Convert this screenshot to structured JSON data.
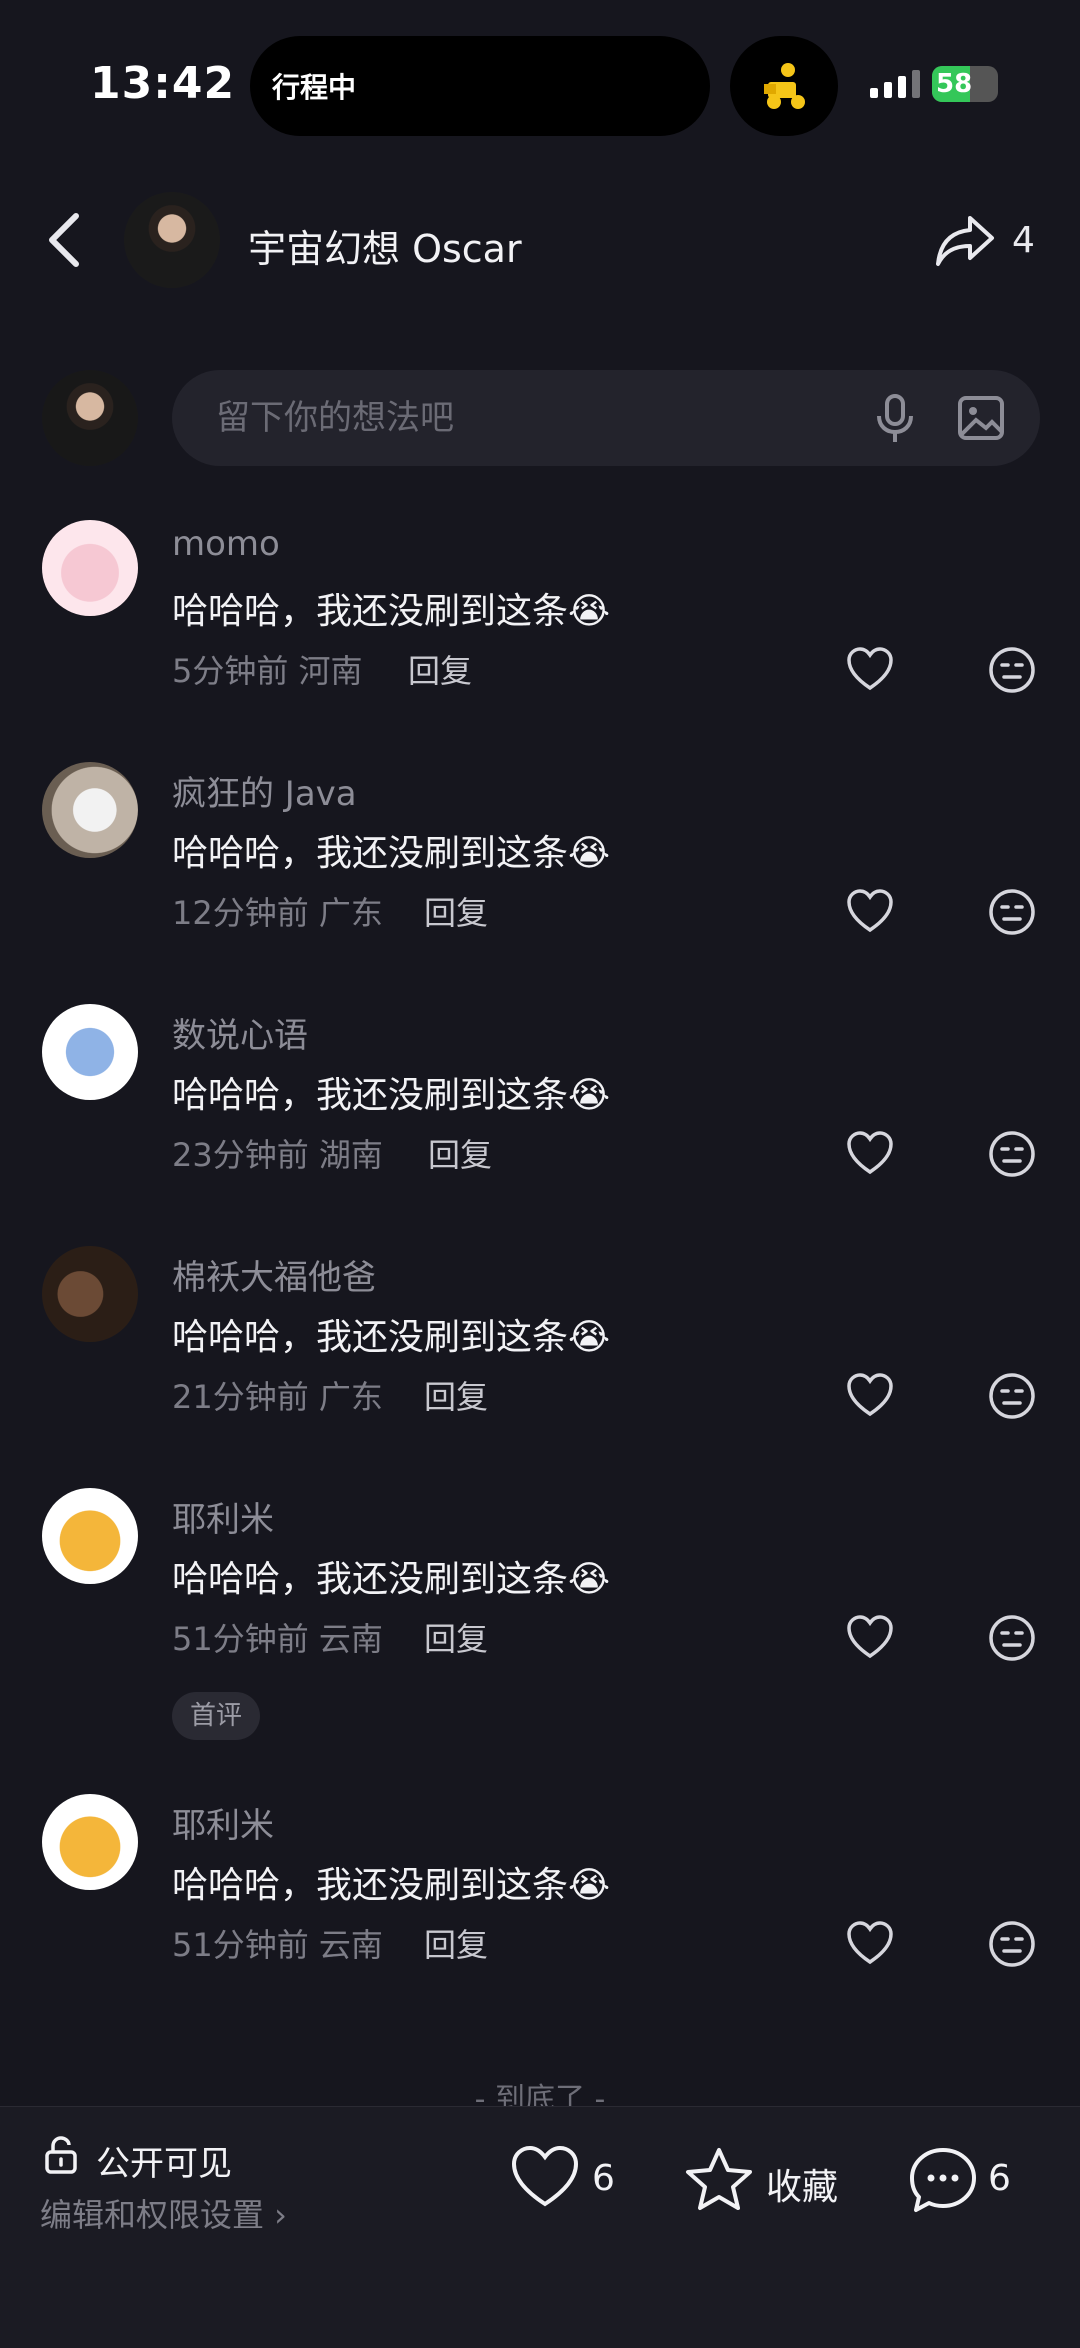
{
  "status_bar": {
    "time": "13:42",
    "island_text": "行程中",
    "battery": "58"
  },
  "header": {
    "title": "宇宙幻想 Oscar",
    "share_count": "4"
  },
  "composer": {
    "placeholder": "留下你的想法吧"
  },
  "comments": [
    {
      "name": "momo",
      "text": "哈哈哈，我还没刷到这条😭",
      "time": "5分钟前",
      "location": "河南",
      "reply": "回复"
    },
    {
      "name": "疯狂的 Java",
      "text": "哈哈哈，我还没刷到这条😭",
      "time": "12分钟前",
      "location": "广东",
      "reply": "回复"
    },
    {
      "name": "数说心语",
      "text": "哈哈哈，我还没刷到这条😭",
      "time": "23分钟前",
      "location": "湖南",
      "reply": "回复"
    },
    {
      "name": "棉袄大福他爸",
      "text": "哈哈哈，我还没刷到这条😭",
      "time": "21分钟前",
      "location": "广东",
      "reply": "回复"
    },
    {
      "name": "耶利米",
      "text": "哈哈哈，我还没刷到这条😭",
      "time": "51分钟前",
      "location": "云南",
      "reply": "回复",
      "badge": "首评"
    },
    {
      "name": "耶利米",
      "text": "哈哈哈，我还没刷到这条😭",
      "time": "51分钟前",
      "location": "云南",
      "reply": "回复"
    }
  ],
  "end_text": "- 到底了 -",
  "bottom_bar": {
    "visibility": "公开可见",
    "edit_permissions": "编辑和权限设置 ›",
    "like_count": "6",
    "favorite_label": "收藏",
    "comment_count": "6"
  },
  "colors": {
    "background": "#16161e",
    "battery_green": "#34c759"
  }
}
